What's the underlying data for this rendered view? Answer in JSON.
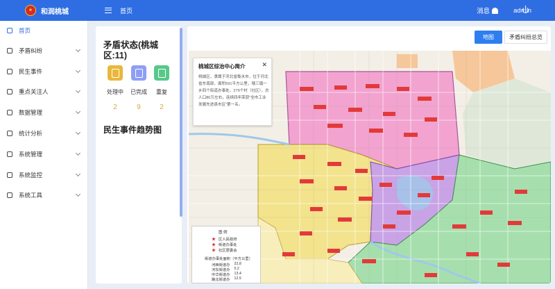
{
  "app": {
    "title": "和润桃城",
    "logo_icon": "emblem-icon"
  },
  "topbar": {
    "breadcrumb": "首页",
    "messages_label": "消息",
    "user": "admin",
    "accent": "#2f6ee2"
  },
  "sidebar": {
    "items": [
      {
        "label": "首页",
        "icon": "home-icon",
        "active": true,
        "expandable": false
      },
      {
        "label": "矛盾纠纷",
        "icon": "dispute-icon",
        "active": false,
        "expandable": true
      },
      {
        "label": "民生事件",
        "icon": "person-icon",
        "active": false,
        "expandable": true
      },
      {
        "label": "重点关注人",
        "icon": "people-icon",
        "active": false,
        "expandable": true
      },
      {
        "label": "数据管理",
        "icon": "chart-icon",
        "active": false,
        "expandable": true
      },
      {
        "label": "统计分析",
        "icon": "stats-icon",
        "active": false,
        "expandable": true
      },
      {
        "label": "系统管理",
        "icon": "settings-icon",
        "active": false,
        "expandable": true
      },
      {
        "label": "系统监控",
        "icon": "monitor-icon",
        "active": false,
        "expandable": true
      },
      {
        "label": "系统工具",
        "icon": "toolbox-icon",
        "active": false,
        "expandable": true
      }
    ]
  },
  "left_panel": {
    "title": "矛盾状态(桃城区:11)",
    "stats": [
      {
        "label": "处理中",
        "count": "2",
        "color": "#e9b73b",
        "icon": "edit-icon"
      },
      {
        "label": "已完成",
        "count": "9",
        "color": "#8f9ef5",
        "icon": "copy-icon"
      },
      {
        "label": "重复",
        "count": "2",
        "color": "#57c88a",
        "icon": "link-icon"
      }
    ],
    "trend_title": "民生事件趋势图"
  },
  "map_view": {
    "tabs": [
      {
        "label": "地图",
        "active": true
      },
      {
        "label": "矛盾纠纷总览",
        "active": false
      }
    ],
    "info_card": {
      "title": "桃城区综治中心简介",
      "body": "桃城区，隶属于河北省衡水市，位于河北省东南部，面积591平方公里，辖三镇一乡四个街道办事处，279个村（社区），总人口80万左右，连续四年荣获“全市工业发展先进县市区”第一名。"
    },
    "legend": {
      "title": "图  例",
      "rows": [
        "区人民政府",
        "街道办事处",
        "社区居委会"
      ],
      "area_title": "街道办事处面积（平方公里）",
      "areas": [
        {
          "name": "河西街道办",
          "value": "22.8"
        },
        {
          "name": "河东街道办",
          "value": "5.2"
        },
        {
          "name": "中华街道办",
          "value": "13.4"
        },
        {
          "name": "路北街道办",
          "value": "12.5"
        }
      ]
    },
    "region_colors": {
      "pink": "#f2a3cf",
      "yellow": "#f3e38c",
      "purple": "#c9a3e6",
      "green": "#a6dfad",
      "orange": "#f6c79a",
      "water": "#9fc8ea",
      "pale_yellow": "#f7eebb"
    }
  }
}
